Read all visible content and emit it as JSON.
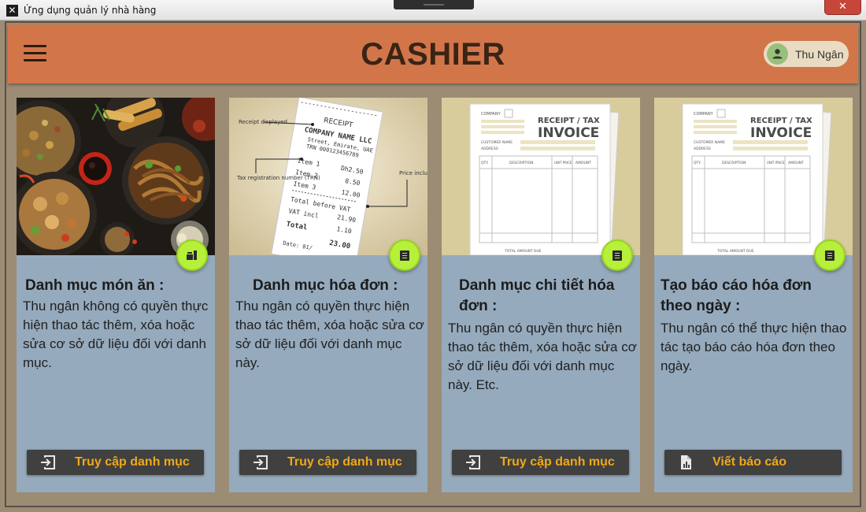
{
  "window": {
    "title": "Ứng dụng quản lý nhà hàng",
    "close_glyph": "✕",
    "app_glyph": "✕"
  },
  "header": {
    "title": "CASHIER",
    "user_name": "Thu Ngân",
    "menu_icon": "hamburger-icon",
    "user_icon": "person-icon"
  },
  "colors": {
    "header": "#d2764a",
    "card": "#96aabd",
    "background": "#9c8c74",
    "fab": "#b6f03a",
    "button": "#404040",
    "button_text": "#f0a818"
  },
  "cards": [
    {
      "title": "Danh mục món ăn :",
      "description": "Thu ngân không có quyền thực hiện thao tác thêm, xóa hoặc sửa cơ sở dữ liệu đối với danh mục.",
      "button_label": "Truy cập danh mục",
      "button_icon": "login-arrow-icon",
      "fab_icon": "food-icon",
      "image": "food-photo"
    },
    {
      "title": "Danh mục hóa đơn :",
      "description": "Thu ngân có quyền thực hiện thao tác thêm, xóa hoặc sửa cơ sở dữ liệu đối với danh mục này.",
      "button_label": "Truy cập danh mục",
      "button_icon": "login-arrow-icon",
      "fab_icon": "receipt-icon",
      "image": "receipt-photo",
      "image_text": {
        "receipt": "RECEIPT",
        "company": "COMPANY NAME LLC",
        "street": "Street, Emirate, UAE",
        "trn": "TRN 000123456789",
        "items": [
          "Item 1",
          "Item 2",
          "Item 3"
        ],
        "amounts": [
          "Dh2.50",
          "8.50",
          "12.00"
        ],
        "total_before_vat": "Total before VAT",
        "total_before_vat_value": "21.90",
        "vat_incl": "VAT incl",
        "vat_value": "1.10",
        "total": "Total",
        "total_value": "23.00",
        "date": "Date: 01/",
        "note_receipt": "Receipt displayed",
        "note_trn": "Tax registration number (TRN)",
        "note_price": "Price includes VAT"
      }
    },
    {
      "title": "Danh mục chi tiết hóa đơn :",
      "description": "Thu ngân có quyền thực hiện thao tác thêm, xóa hoặc sửa cơ sở dữ liệu đối với danh mục này. Etc.",
      "button_label": "Truy cập danh mục",
      "button_icon": "login-arrow-icon",
      "fab_icon": "receipt-icon",
      "image": "invoice-document",
      "image_text": {
        "receipt_tax": "RECEIPT / TAX",
        "invoice": "INVOICE",
        "company": "COMPANY",
        "customer_name": "CUSTOMER NAME",
        "address": "ADDRESS",
        "qty": "QTY.",
        "description": "DESCRIPTION",
        "unit_price": "UNIT PRICE",
        "amount": "AMOUNT",
        "total_amount_due": "TOTAL AMOUNT DUE"
      }
    },
    {
      "title": "Tạo báo cáo hóa đơn theo ngày :",
      "description": "Thu ngân có thể thực hiện thao tác tạo báo cáo hóa đơn theo ngày.",
      "button_label": "Viết báo cáo",
      "button_icon": "report-file-icon",
      "fab_icon": "receipt-icon",
      "image": "invoice-document"
    }
  ]
}
